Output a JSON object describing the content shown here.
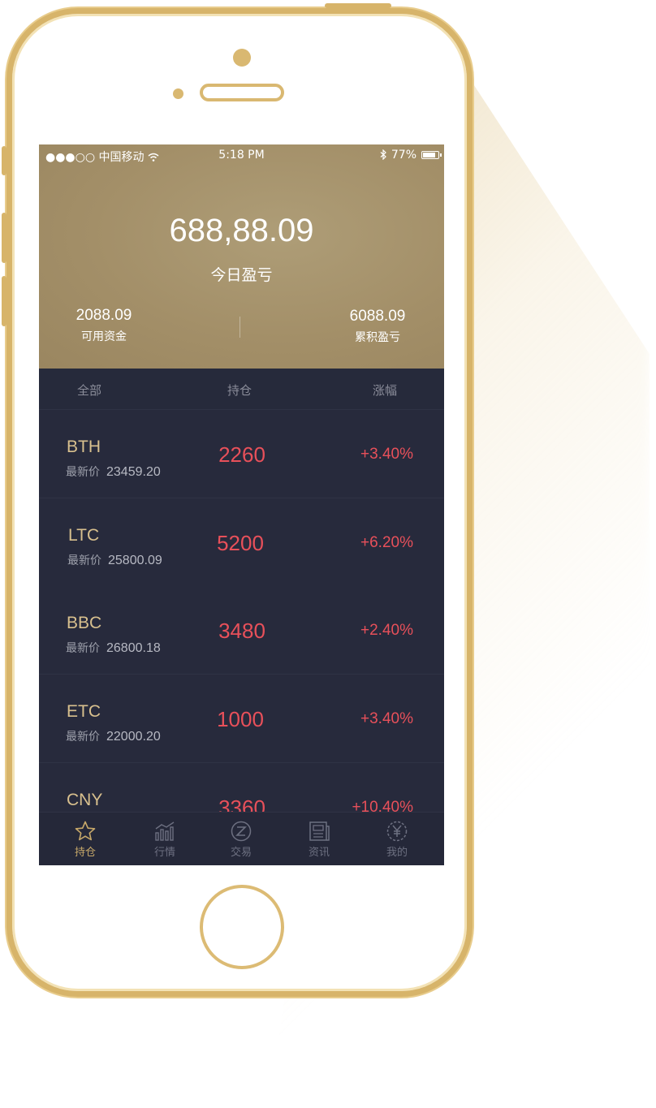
{
  "status_bar": {
    "carrier": "●●●○○ 中国移动",
    "time": "5:18 PM",
    "battery": "77%"
  },
  "summary": {
    "today_pnl": "688,88.09",
    "today_pnl_label": "今日盈亏",
    "available_funds": "2088.09",
    "available_funds_label": "可用资金",
    "cumulative_pnl": "6088.09",
    "cumulative_pnl_label": "累积盈亏"
  },
  "columns": {
    "all": "全部",
    "holding": "持仓",
    "change": "涨幅"
  },
  "holdings": [
    {
      "symbol": "BTH",
      "price_label": "最新价",
      "price": "23459.20",
      "holding": "2260",
      "change": "+3.40%"
    },
    {
      "symbol": "LTC",
      "price_label": "最新价",
      "price": "25800.09",
      "holding": "5200",
      "change": "+6.20%"
    },
    {
      "symbol": "BBC",
      "price_label": "最新价",
      "price": "26800.18",
      "holding": "3480",
      "change": "+2.40%"
    },
    {
      "symbol": "ETC",
      "price_label": "最新价",
      "price": "22000.20",
      "holding": "1000",
      "change": "+3.40%"
    },
    {
      "symbol": "CNY",
      "price_label": "",
      "price": "",
      "holding": "3360",
      "change": "+10.40%"
    }
  ],
  "tabs": [
    {
      "label": "持仓",
      "icon": "star-icon"
    },
    {
      "label": "行情",
      "icon": "chart-icon"
    },
    {
      "label": "交易",
      "icon": "trade-icon"
    },
    {
      "label": "资讯",
      "icon": "news-icon"
    },
    {
      "label": "我的",
      "icon": "yuan-icon"
    }
  ],
  "colors": {
    "accent_gold": "#c8a96a",
    "gain_red": "#e8505a",
    "list_bg": "#272a3c"
  }
}
